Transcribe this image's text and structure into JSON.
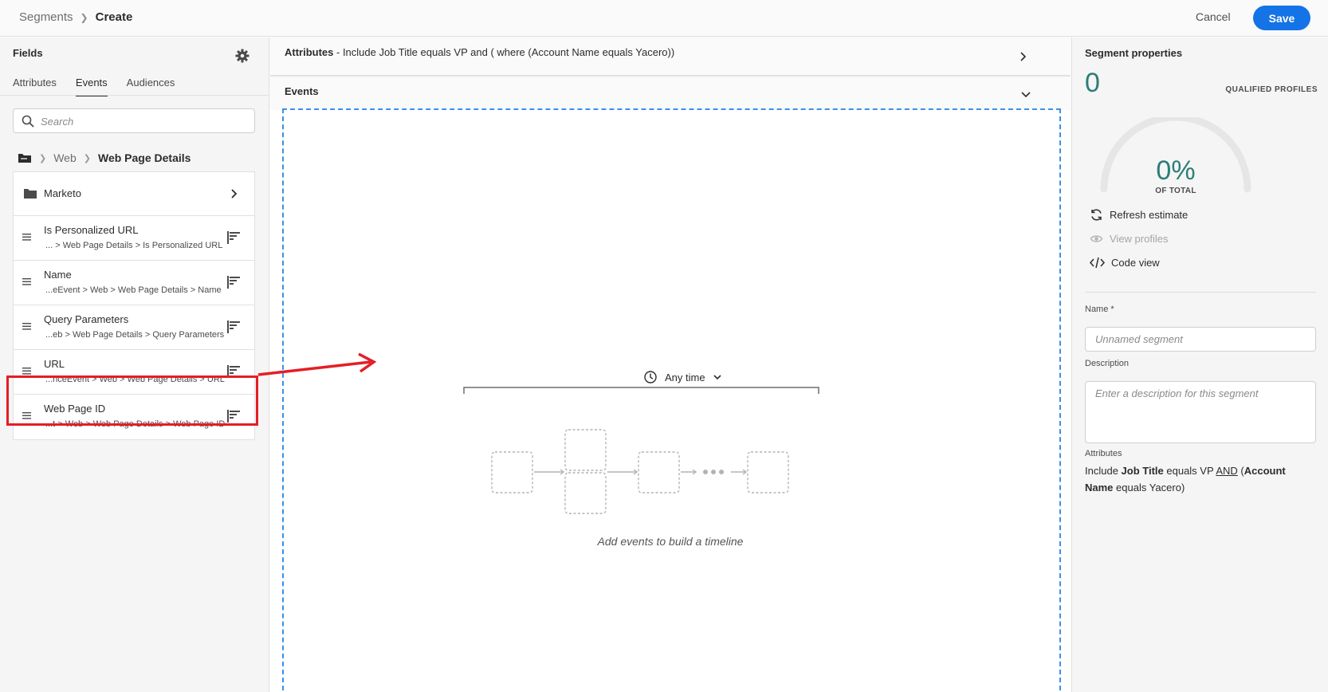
{
  "header": {
    "breadcrumb_root": "Segments",
    "breadcrumb_current": "Create",
    "cancel_label": "Cancel",
    "save_label": "Save"
  },
  "fields_panel": {
    "title": "Fields",
    "tabs": [
      {
        "label": "Attributes",
        "active": false
      },
      {
        "label": "Events",
        "active": true
      },
      {
        "label": "Audiences",
        "active": false
      }
    ],
    "search_placeholder": "Search",
    "path": {
      "parent": "Web",
      "current": "Web Page Details"
    },
    "folder": {
      "label": "Marketo"
    },
    "items": [
      {
        "name": "Is Personalized URL",
        "path": "... > Web Page Details > Is Personalized URL"
      },
      {
        "name": "Name",
        "path": "...eEvent > Web > Web Page Details > Name"
      },
      {
        "name": "Query Parameters",
        "path": "...eb > Web Page Details > Query Parameters"
      },
      {
        "name": "URL",
        "path": "...nceEvent > Web > Web Page Details > URL"
      },
      {
        "name": "Web Page ID",
        "path": "...t > Web > Web Page Details > Web Page ID"
      }
    ]
  },
  "canvas": {
    "attributes_label": "Attributes",
    "attributes_summary": " - Include Job Title equals VP and ( where (Account Name equals Yacero))",
    "events_label": "Events",
    "time_filter": "Any time",
    "empty_caption": "Add events to build a timeline"
  },
  "properties": {
    "title": "Segment properties",
    "qualified_count": "0",
    "qualified_label": "QUALIFIED PROFILES",
    "percent": "0%",
    "percent_label": "OF TOTAL",
    "actions": [
      {
        "label": "Refresh estimate",
        "icon": "refresh-icon",
        "enabled": true
      },
      {
        "label": "View profiles",
        "icon": "eye-icon",
        "enabled": false
      },
      {
        "label": "Code view",
        "icon": "code-icon",
        "enabled": true
      }
    ],
    "name_label": "Name *",
    "name_placeholder": "Unnamed segment",
    "description_label": "Description",
    "description_placeholder": "Enter a description for this segment",
    "attributes_label": "Attributes",
    "attributes_text": {
      "t1": "Include ",
      "b1": "Job Title",
      "t2": " equals VP ",
      "op": "AND",
      "t3": " (",
      "b2": "Account Name",
      "t4": " equals Yacero)"
    }
  },
  "colors": {
    "accent": "#1473e6",
    "teal": "#2d7d76",
    "highlight_red": "#e41e26",
    "dropzone_border": "#3b8fea"
  }
}
